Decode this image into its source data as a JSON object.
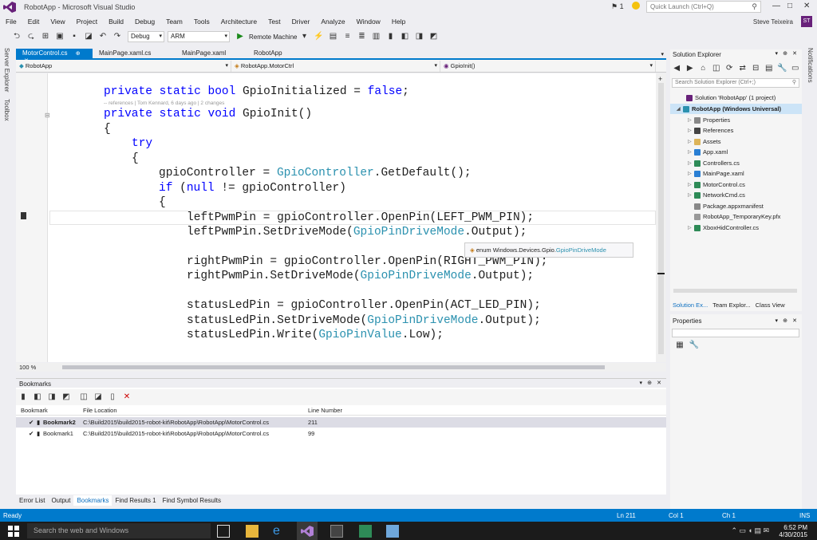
{
  "window": {
    "title": "RobotApp - Microsoft Visual Studio",
    "notification_count": "1",
    "quick_launch_placeholder": "Quick Launch (Ctrl+Q)",
    "user_name": "Steve Teixeira",
    "user_initials": "ST"
  },
  "menu": [
    "File",
    "Edit",
    "View",
    "Project",
    "Build",
    "Debug",
    "Team",
    "Tools",
    "Architecture",
    "Test",
    "Driver",
    "Analyze",
    "Window",
    "Help"
  ],
  "toolbar": {
    "config": "Debug",
    "platform": "ARM",
    "run_target": "Remote Machine"
  },
  "side_tabs": [
    "Server Explorer",
    "Toolbox"
  ],
  "right_side_tab": "Notifications",
  "doc_tabs": [
    {
      "label": "MotorControl.cs",
      "active": true
    },
    {
      "label": "MainPage.xaml.cs",
      "active": false
    },
    {
      "label": "MainPage.xaml",
      "active": false
    },
    {
      "label": "RobotApp",
      "active": false
    }
  ],
  "nav": {
    "project": "RobotApp",
    "type": "RobotApp.MotorCtrl",
    "member": "GpioInit()"
  },
  "code": {
    "lens": "-- references | Tom Kennard, 6 days ago | 2 changes",
    "l1": {
      "kw": "private static bool",
      "name": " GpioInitialized = ",
      "val": "false",
      "end": ";"
    },
    "l2": {
      "kw": "private static void",
      "rest": " GpioInit()"
    },
    "l3": "{",
    "l4": "try",
    "l5": "{",
    "l6": {
      "a": "gpioController = ",
      "t": "GpioController",
      "b": ".GetDefault();"
    },
    "l7": {
      "kw": "if",
      "a": " (",
      "kw2": "null",
      "b": " != gpioController)"
    },
    "l8": "{",
    "l9": "leftPwmPin = gpioController.OpenPin(LEFT_PWM_PIN);",
    "l10": {
      "a": "leftPwmPin.SetDriveMode(",
      "t": "GpioPinDriveMode",
      "b": ".Output);"
    },
    "l11": "rightPwmPin = gpioController.OpenPin(RIGHT_PWM_PIN);",
    "l12": {
      "a": "rightPwmPin.SetDriveMode(",
      "t": "GpioPinDriveMode",
      "b": ".Output);"
    },
    "l13": "statusLedPin = gpioController.OpenPin(ACT_LED_PIN);",
    "l14": {
      "a": "statusLedPin.SetDriveMode(",
      "t": "GpioPinDriveMode",
      "b": ".Output);"
    },
    "l15": {
      "a": "statusLedPin.Write(",
      "t": "GpioPinValue",
      "b": ".Low);"
    },
    "tooltip": {
      "prefix": "enum Windows.Devices.Gpio.",
      "type": "GpioPinDriveMode"
    }
  },
  "zoom": "100 %",
  "bookmarks": {
    "title": "Bookmarks",
    "columns": [
      "Bookmark",
      "File Location",
      "Line Number"
    ],
    "rows": [
      {
        "name": "Bookmark2",
        "location": "C:\\Build2015\\build2015-robot-kit\\RobotApp\\RobotApp\\MotorControl.cs",
        "line": "211"
      },
      {
        "name": "Bookmark1",
        "location": "C:\\Build2015\\build2015-robot-kit\\RobotApp\\RobotApp\\MotorControl.cs",
        "line": "99"
      }
    ]
  },
  "bottom_tabs": [
    "Error List",
    "Output",
    "Bookmarks",
    "Find Results 1",
    "Find Symbol Results"
  ],
  "solution_explorer": {
    "title": "Solution Explorer",
    "search_placeholder": "Search Solution Explorer (Ctrl+;)",
    "items": [
      {
        "label": "Solution 'RobotApp' (1 project)",
        "indent": 0
      },
      {
        "label": "RobotApp (Windows Universal)",
        "indent": 1
      },
      {
        "label": "Properties",
        "indent": 2
      },
      {
        "label": "References",
        "indent": 2
      },
      {
        "label": "Assets",
        "indent": 2
      },
      {
        "label": "App.xaml",
        "indent": 2
      },
      {
        "label": "Controllers.cs",
        "indent": 2
      },
      {
        "label": "MainPage.xaml",
        "indent": 2
      },
      {
        "label": "MotorControl.cs",
        "indent": 2
      },
      {
        "label": "NetworkCmd.cs",
        "indent": 2
      },
      {
        "label": "Package.appxmanifest",
        "indent": 2
      },
      {
        "label": "RobotApp_TemporaryKey.pfx",
        "indent": 2
      },
      {
        "label": "XboxHidController.cs",
        "indent": 2
      }
    ],
    "tabs": [
      "Solution Ex...",
      "Team Explor...",
      "Class View"
    ]
  },
  "properties": {
    "title": "Properties"
  },
  "status": {
    "ready": "Ready",
    "ln": "Ln 211",
    "col": "Col 1",
    "ch": "Ch 1",
    "ins": "INS"
  },
  "taskbar": {
    "search_placeholder": "Search the web and Windows",
    "time": "6:52 PM",
    "date": "4/30/2015"
  },
  "colors": {
    "accent": "#007acc",
    "keyword": "#0000ff",
    "type": "#2b91af",
    "vs_purple": "#68217a"
  }
}
